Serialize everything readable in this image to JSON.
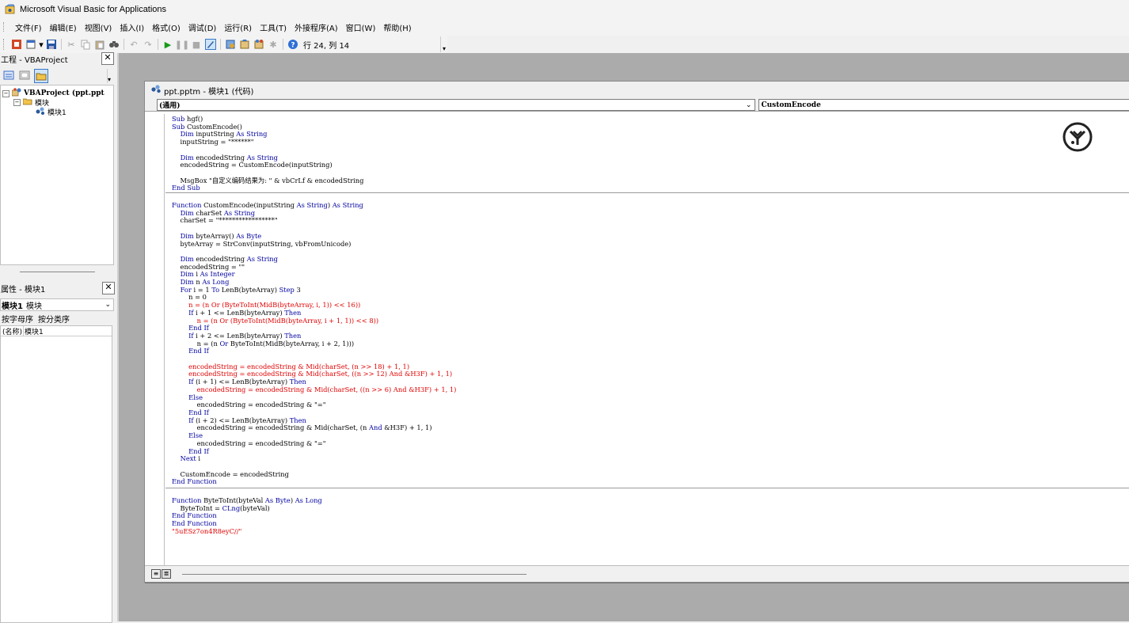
{
  "window": {
    "title": "Microsoft Visual Basic for Applications"
  },
  "menu": [
    "文件(F)",
    "编辑(E)",
    "视图(V)",
    "插入(I)",
    "格式(O)",
    "调试(D)",
    "运行(R)",
    "工具(T)",
    "外接程序(A)",
    "窗口(W)",
    "帮助(H)"
  ],
  "toolbar": {
    "cursor_pos": "行 24, 列 14"
  },
  "project": {
    "title": "工程 - VBAProject",
    "root": "VBAProject (ppt.ppt",
    "folder": "模块",
    "module": "模块1"
  },
  "properties": {
    "title": "属性 - 模块1",
    "object": "模块1",
    "object_type": "模块",
    "tab_alpha": "按字母序",
    "tab_cat": "按分类序",
    "name_key": "(名称)",
    "name_value": "模块1"
  },
  "codewin": {
    "title": "ppt.pptm - 模块1 (代码)",
    "object_combo": "(通用)",
    "proc_combo": "CustomEncode"
  },
  "code": {
    "block1": [
      [
        [
          "k",
          "Sub "
        ],
        [
          "n",
          "hgf()"
        ]
      ],
      [
        [
          "k",
          "Sub "
        ],
        [
          "n",
          "CustomEncode()"
        ]
      ],
      [
        [
          "n",
          "    "
        ],
        [
          "k",
          "Dim "
        ],
        [
          "n",
          "inputString "
        ],
        [
          "k",
          "As String"
        ]
      ],
      [
        [
          "n",
          "    inputString = \"******\""
        ]
      ],
      [
        [
          "n",
          ""
        ]
      ],
      [
        [
          "n",
          "    "
        ],
        [
          "k",
          "Dim "
        ],
        [
          "n",
          "encodedString "
        ],
        [
          "k",
          "As String"
        ]
      ],
      [
        [
          "n",
          "    encodedString = CustomEncode(inputString)"
        ]
      ],
      [
        [
          "n",
          ""
        ]
      ],
      [
        [
          "n",
          "    MsgBox \"自定义编码结果为: \" & vbCrLf & encodedString"
        ]
      ],
      [
        [
          "k",
          "End Sub"
        ]
      ]
    ],
    "block2": [
      [
        [
          "k",
          "Function "
        ],
        [
          "n",
          "CustomEncode(inputString "
        ],
        [
          "k",
          "As String"
        ],
        [
          "n",
          ") "
        ],
        [
          "k",
          "As String"
        ]
      ],
      [
        [
          "n",
          "    "
        ],
        [
          "k",
          "Dim "
        ],
        [
          "n",
          "charSet "
        ],
        [
          "k",
          "As String"
        ]
      ],
      [
        [
          "n",
          "    charSet = \"*****************\""
        ]
      ],
      [
        [
          "n",
          ""
        ]
      ],
      [
        [
          "n",
          "    "
        ],
        [
          "k",
          "Dim "
        ],
        [
          "n",
          "byteArray() "
        ],
        [
          "k",
          "As Byte"
        ]
      ],
      [
        [
          "n",
          "    byteArray = StrConv(inputString, vbFromUnicode)"
        ]
      ],
      [
        [
          "n",
          ""
        ]
      ],
      [
        [
          "n",
          "    "
        ],
        [
          "k",
          "Dim "
        ],
        [
          "n",
          "encodedString "
        ],
        [
          "k",
          "As String"
        ]
      ],
      [
        [
          "n",
          "    encodedString = \"\""
        ]
      ],
      [
        [
          "n",
          "    "
        ],
        [
          "k",
          "Dim "
        ],
        [
          "n",
          "i "
        ],
        [
          "k",
          "As Integer"
        ]
      ],
      [
        [
          "n",
          "    "
        ],
        [
          "k",
          "Dim "
        ],
        [
          "n",
          "n "
        ],
        [
          "k",
          "As Long"
        ]
      ],
      [
        [
          "n",
          "    "
        ],
        [
          "k",
          "For "
        ],
        [
          "n",
          "i = 1 "
        ],
        [
          "k",
          "To "
        ],
        [
          "n",
          "LenB(byteArray) "
        ],
        [
          "k",
          "Step "
        ],
        [
          "n",
          "3"
        ]
      ],
      [
        [
          "n",
          "        n = 0"
        ]
      ],
      [
        [
          "r",
          "        n = (n Or (ByteToInt(MidB(byteArray, i, 1)) << 16))"
        ]
      ],
      [
        [
          "n",
          "        "
        ],
        [
          "k",
          "If "
        ],
        [
          "n",
          "i + 1 <= LenB(byteArray) "
        ],
        [
          "k",
          "Then"
        ]
      ],
      [
        [
          "r",
          "            n = (n Or (ByteToInt(MidB(byteArray, i + 1, 1)) << 8))"
        ]
      ],
      [
        [
          "n",
          "        "
        ],
        [
          "k",
          "End If"
        ]
      ],
      [
        [
          "n",
          "        "
        ],
        [
          "k",
          "If "
        ],
        [
          "n",
          "i + 2 <= LenB(byteArray) "
        ],
        [
          "k",
          "Then"
        ]
      ],
      [
        [
          "n",
          "            n = (n "
        ],
        [
          "k",
          "Or "
        ],
        [
          "n",
          "ByteToInt(MidB(byteArray, i + 2, 1)))"
        ]
      ],
      [
        [
          "n",
          "        "
        ],
        [
          "k",
          "End If"
        ]
      ],
      [
        [
          "n",
          ""
        ]
      ],
      [
        [
          "r",
          "        encodedString = encodedString & Mid(charSet, (n >> 18) + 1, 1)"
        ]
      ],
      [
        [
          "r",
          "        encodedString = encodedString & Mid(charSet, ((n >> 12) And &H3F) + 1, 1)"
        ]
      ],
      [
        [
          "n",
          "        "
        ],
        [
          "k",
          "If "
        ],
        [
          "n",
          "(i + 1) <= LenB(byteArray) "
        ],
        [
          "k",
          "Then"
        ]
      ],
      [
        [
          "r",
          "            encodedString = encodedString & Mid(charSet, ((n >> 6) And &H3F) + 1, 1)"
        ]
      ],
      [
        [
          "n",
          "        "
        ],
        [
          "k",
          "Else"
        ]
      ],
      [
        [
          "n",
          "            encodedString = encodedString & \"=\""
        ]
      ],
      [
        [
          "n",
          "        "
        ],
        [
          "k",
          "End If"
        ]
      ],
      [
        [
          "n",
          "        "
        ],
        [
          "k",
          "If "
        ],
        [
          "n",
          "(i + 2) <= LenB(byteArray) "
        ],
        [
          "k",
          "Then"
        ]
      ],
      [
        [
          "n",
          "            encodedString = encodedString & Mid(charSet, (n "
        ],
        [
          "k",
          "And "
        ],
        [
          "n",
          "&H3F) + 1, 1)"
        ]
      ],
      [
        [
          "n",
          "        "
        ],
        [
          "k",
          "Else"
        ]
      ],
      [
        [
          "n",
          "            encodedString = encodedString & \"=\""
        ]
      ],
      [
        [
          "n",
          "        "
        ],
        [
          "k",
          "End If"
        ]
      ],
      [
        [
          "n",
          "    "
        ],
        [
          "k",
          "Next "
        ],
        [
          "n",
          "i"
        ]
      ],
      [
        [
          "n",
          ""
        ]
      ],
      [
        [
          "n",
          "    CustomEncode = encodedString"
        ]
      ],
      [
        [
          "k",
          "End Function"
        ]
      ]
    ],
    "block3": [
      [
        [
          "k",
          "Function "
        ],
        [
          "n",
          "ByteToInt(byteVal "
        ],
        [
          "k",
          "As Byte"
        ],
        [
          "n",
          ") "
        ],
        [
          "k",
          "As Long"
        ]
      ],
      [
        [
          "n",
          "    ByteToInt = "
        ],
        [
          "k",
          "CLng"
        ],
        [
          "n",
          "(byteVal)"
        ]
      ],
      [
        [
          "k",
          "End Function"
        ]
      ],
      [
        [
          "k",
          "End Function"
        ]
      ],
      [
        [
          "r",
          "\"5uESz7on4R8eyC//\""
        ]
      ]
    ]
  }
}
